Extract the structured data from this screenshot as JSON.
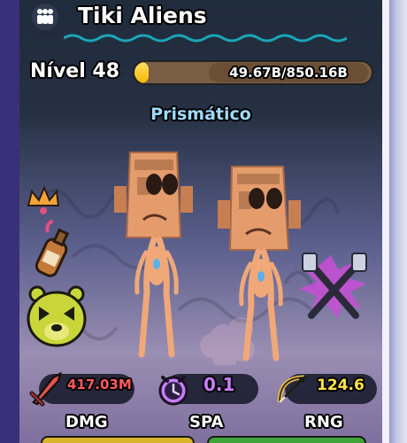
{
  "unit": {
    "name": "Tiki Aliens",
    "rarity": "Prismático"
  },
  "level": {
    "label": "Nível 48",
    "xp_text": "49.67B/850.16B",
    "xp_fraction": 0.058
  },
  "stats": {
    "dmg": {
      "value": "417.03M",
      "label": "DMG",
      "color": "#ff5a5a"
    },
    "spa": {
      "value": "0.1",
      "label": "SPA",
      "color": "#c77dff"
    },
    "rng": {
      "value": "124.6",
      "label": "RNG",
      "color": "#ffe34a"
    }
  },
  "icons": {
    "title": "group-icon",
    "crown": "crown-icon",
    "bottle": "bottle-icon",
    "bear": "bear-icon",
    "utensils": "crossed-utensils-icon",
    "dmg": "sword-icon",
    "spa": "clock-icon",
    "rng": "bow-icon"
  }
}
